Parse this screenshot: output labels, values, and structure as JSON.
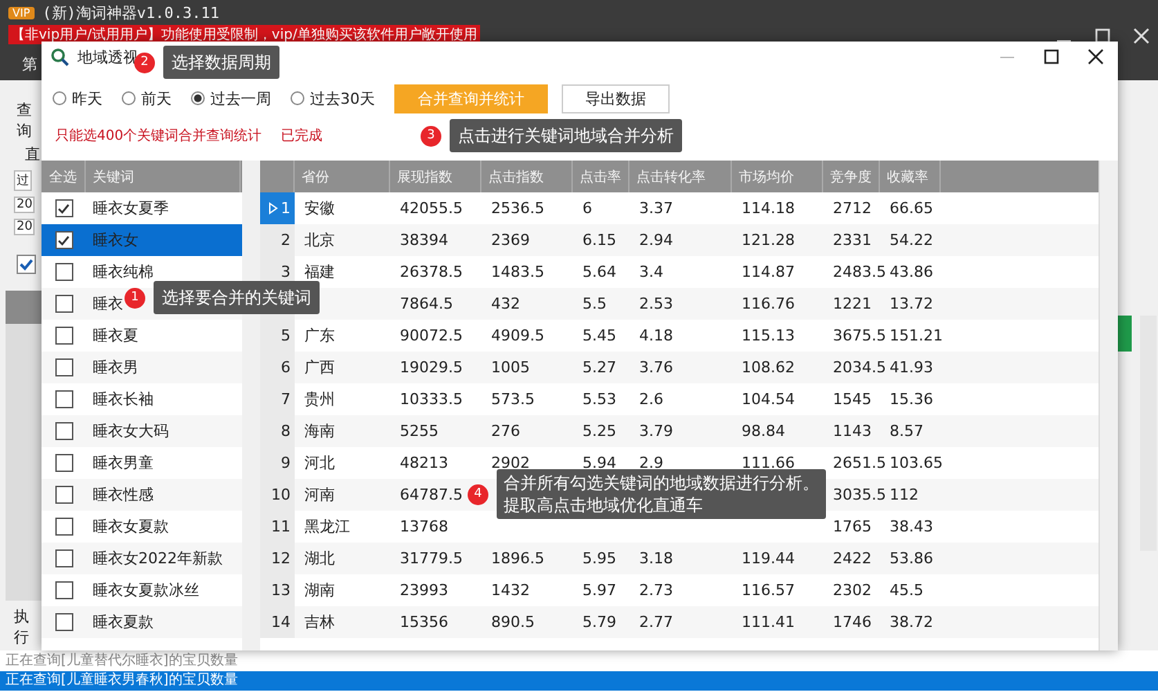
{
  "app": {
    "badge": "VIP",
    "title": "(新)淘词神器v1.0.3.11",
    "banner": "【非vip用户/试用用户】功能使用受限制，vip/单独购买该软件用户敞开使用",
    "left_fragments": [
      "第",
      "查询",
      "直",
      "过",
      "20",
      "20"
    ],
    "left_checkbox": {
      "checked": true
    },
    "exec_label": "执行",
    "status_lines": [
      {
        "text": "正在查询[儿童替代尔睡衣]的宝贝数量",
        "selected": false
      },
      {
        "text": "正在查询[儿童睡衣男春秋]的宝贝数量",
        "selected": true
      }
    ]
  },
  "dialog": {
    "title": "地域透视",
    "periods": [
      {
        "label": "昨天",
        "selected": false
      },
      {
        "label": "前天",
        "selected": false
      },
      {
        "label": "过去一周",
        "selected": true
      },
      {
        "label": "过去30天",
        "selected": false
      }
    ],
    "buttons": [
      {
        "label": "合并查询并统计",
        "kind": "primary"
      },
      {
        "label": "导出数据",
        "kind": "normal"
      }
    ],
    "notes": [
      "只能选400个关键词合并查询统计",
      "已完成"
    ],
    "keyword_list": {
      "columns": [
        "全选",
        "关键词"
      ],
      "items": [
        {
          "text": "睡衣女夏季",
          "checked": true,
          "selected": false
        },
        {
          "text": "睡衣女",
          "checked": true,
          "selected": true
        },
        {
          "text": "睡衣纯棉",
          "checked": false,
          "selected": false
        },
        {
          "text": "睡衣",
          "checked": false,
          "selected": false
        },
        {
          "text": "睡衣夏",
          "checked": false,
          "selected": false
        },
        {
          "text": "睡衣男",
          "checked": false,
          "selected": false
        },
        {
          "text": "睡衣长袖",
          "checked": false,
          "selected": false
        },
        {
          "text": "睡衣女大码",
          "checked": false,
          "selected": false
        },
        {
          "text": "睡衣男童",
          "checked": false,
          "selected": false
        },
        {
          "text": "睡衣性感",
          "checked": false,
          "selected": false
        },
        {
          "text": "睡衣女夏款",
          "checked": false,
          "selected": false
        },
        {
          "text": "睡衣女2022年新款",
          "checked": false,
          "selected": false
        },
        {
          "text": "睡衣女夏款冰丝",
          "checked": false,
          "selected": false
        },
        {
          "text": "睡衣夏款",
          "checked": false,
          "selected": false
        }
      ]
    },
    "table": {
      "columns": [
        "省份",
        "展现指数",
        "点击指数",
        "点击率",
        "点击转化率",
        "市场均价",
        "竞争度",
        "收藏率"
      ],
      "rows": [
        {
          "index": "1",
          "cells": [
            "安徽",
            "42055.5",
            "2536.5",
            "6",
            "3.37",
            "114.18",
            "2712",
            "66.65"
          ],
          "selected": true
        },
        {
          "index": "2",
          "cells": [
            "北京",
            "38394",
            "2369",
            "6.15",
            "2.94",
            "121.28",
            "2331",
            "54.22"
          ],
          "selected": false
        },
        {
          "index": "3",
          "cells": [
            "福建",
            "26378.5",
            "1483.5",
            "5.64",
            "3.4",
            "114.87",
            "2483.5",
            "43.86"
          ],
          "selected": false
        },
        {
          "index": null,
          "cells": [
            null,
            "7864.5",
            "432",
            "5.5",
            "2.53",
            "116.76",
            "1221",
            "13.72"
          ],
          "selected": false
        },
        {
          "index": "5",
          "cells": [
            "广东",
            "90072.5",
            "4909.5",
            "5.45",
            "4.18",
            "115.13",
            "3675.5",
            "151.21"
          ],
          "selected": false
        },
        {
          "index": "6",
          "cells": [
            "广西",
            "19029.5",
            "1005",
            "5.27",
            "3.76",
            "108.62",
            "2034.5",
            "41.93"
          ],
          "selected": false
        },
        {
          "index": "7",
          "cells": [
            "贵州",
            "10333.5",
            "573.5",
            "5.53",
            "2.6",
            "104.54",
            "1545",
            "15.36"
          ],
          "selected": false
        },
        {
          "index": "8",
          "cells": [
            "海南",
            "5255",
            "276",
            "5.25",
            "3.79",
            "98.84",
            "1143",
            "8.57"
          ],
          "selected": false
        },
        {
          "index": "9",
          "cells": [
            "河北",
            "48213",
            "2902",
            "5.94",
            "2.9",
            "111.66",
            "2651.5",
            "103.65"
          ],
          "selected": false
        },
        {
          "index": "10",
          "cells": [
            "河南",
            "64787.5",
            null,
            null,
            null,
            null,
            "3035.5",
            "112"
          ],
          "selected": false
        },
        {
          "index": "11",
          "cells": [
            "黑龙江",
            "13768",
            null,
            null,
            null,
            null,
            "1765",
            "38.43"
          ],
          "selected": false
        },
        {
          "index": "12",
          "cells": [
            "湖北",
            "31779.5",
            "1896.5",
            "5.95",
            "3.18",
            "119.44",
            "2422",
            "53.86"
          ],
          "selected": false
        },
        {
          "index": "13",
          "cells": [
            "湖南",
            "23993",
            "1432",
            "5.97",
            "2.73",
            "116.57",
            "2302",
            "45.5"
          ],
          "selected": false
        },
        {
          "index": "14",
          "cells": [
            "吉林",
            "15356",
            "890.5",
            "5.79",
            "2.77",
            "111.41",
            "1746",
            "38.72"
          ],
          "selected": false
        }
      ]
    }
  },
  "callouts": [
    {
      "number": "2",
      "text": "选择数据周期"
    },
    {
      "number": "3",
      "text": "点击进行关键词地域合并分析"
    },
    {
      "number": "1",
      "text": "选择要合并的关键词"
    },
    {
      "number": "4",
      "text": "合并所有勾选关键词的地域数据进行分析。提取高点击地域优化直通车"
    }
  ]
}
